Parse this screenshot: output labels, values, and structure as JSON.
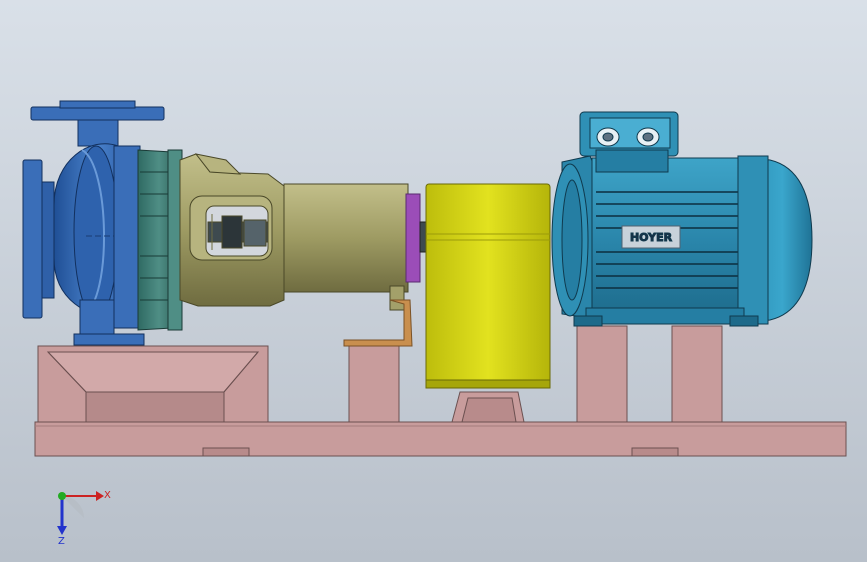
{
  "motor": {
    "brand_label": "HOYER"
  },
  "triad": {
    "x_label": "X",
    "z_label": "Z",
    "x_color": "#cc2222",
    "y_color": "#22aa22",
    "z_color": "#2233cc"
  },
  "colors": {
    "background_top": "#d7dee6",
    "background_bottom": "#b9c1cb",
    "base_frame": "#c89c9c",
    "pump_casing": "#3a6eb8",
    "bearing_frame": "#a3a06a",
    "coupling_guard": "#cfcf12",
    "motor_body": "#2f90b5",
    "seal_ring": "#9b4db8"
  }
}
